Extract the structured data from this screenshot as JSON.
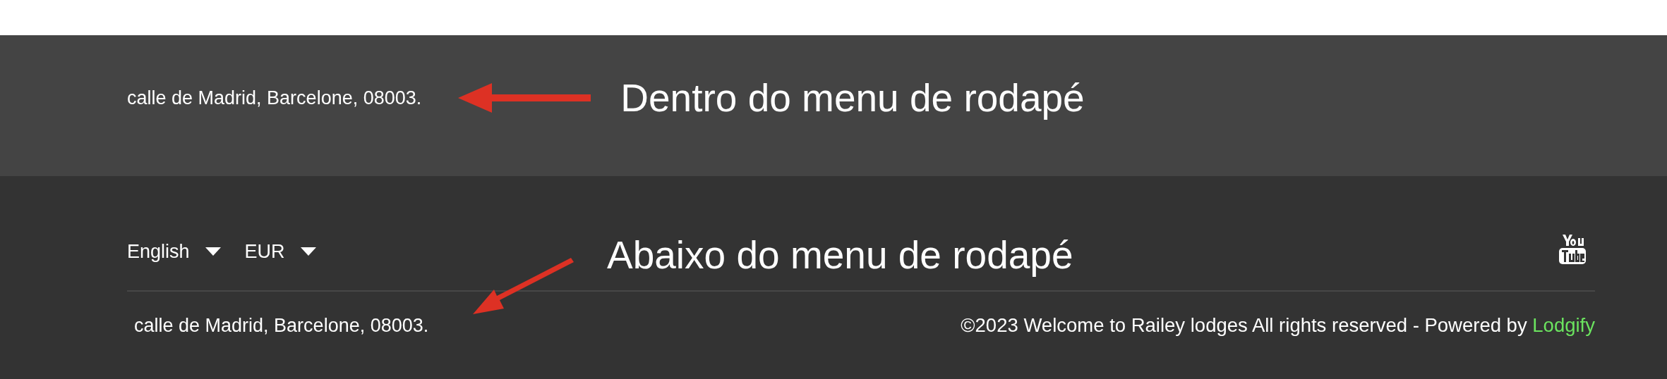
{
  "inner_footer": {
    "address": "calle de Madrid, Barcelone, 08003."
  },
  "bottom_footer": {
    "language": "English",
    "currency": "EUR",
    "address": "calle de Madrid, Barcelone, 08003.",
    "copyright": "©2023 Welcome to Railey lodges All rights reserved - Powered by",
    "powered_by_link": "Lodgify"
  },
  "annotations": [
    {
      "text": "Dentro do menu de rodapé",
      "kind": "left"
    },
    {
      "text": "Abaixo do menu de rodapé",
      "kind": "diagonal"
    }
  ]
}
